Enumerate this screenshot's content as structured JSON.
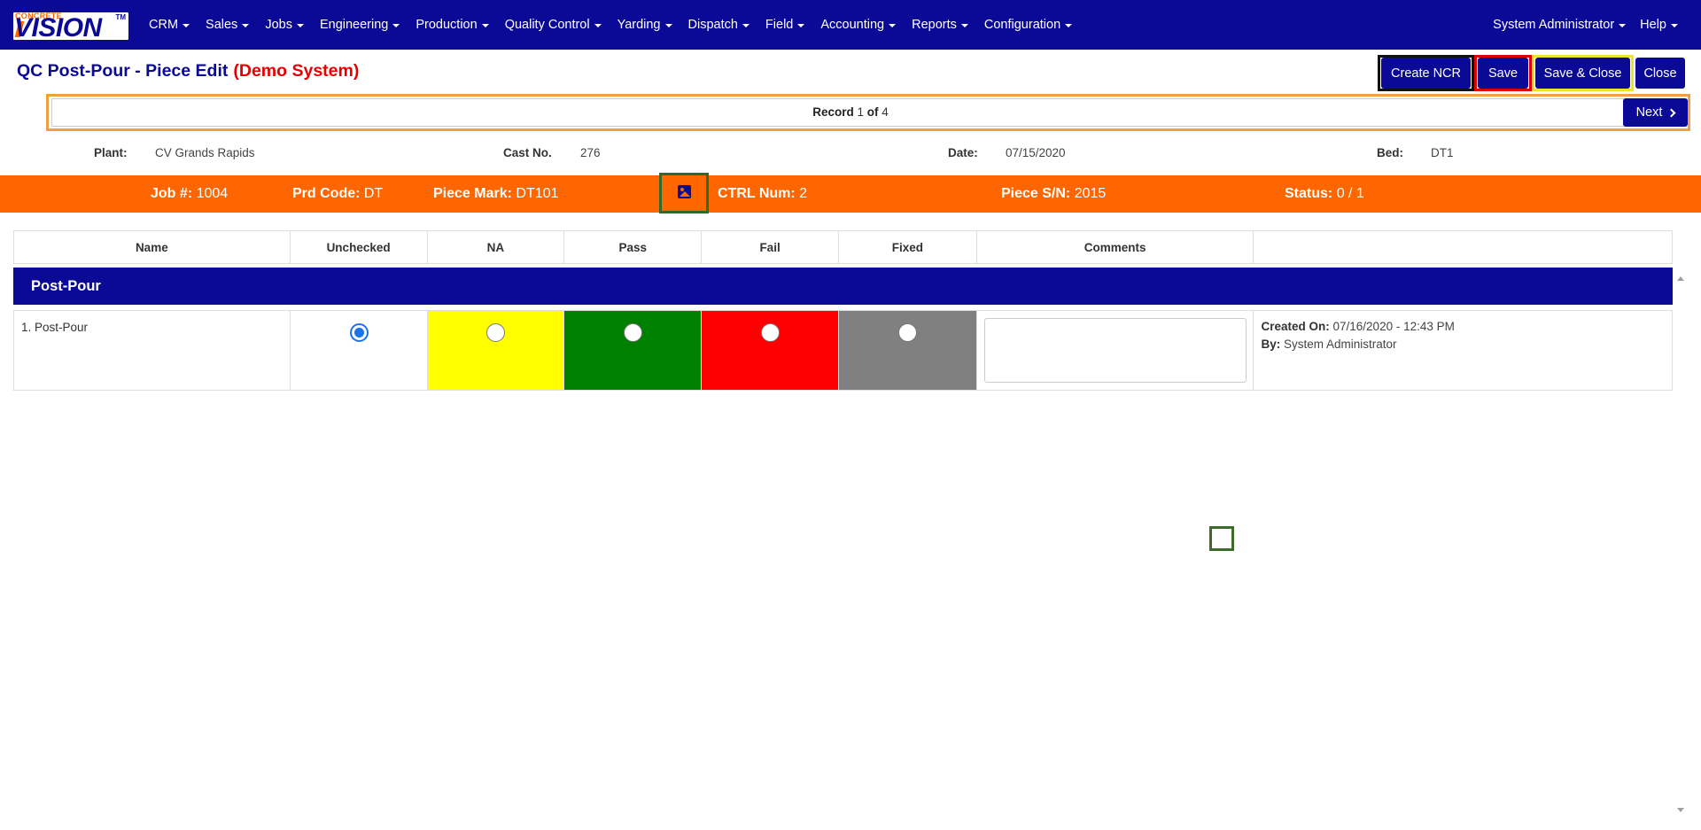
{
  "brand": {
    "top_text": "CONCRETE",
    "main_text": "VISION",
    "tm": "TM"
  },
  "nav": {
    "items": [
      "CRM",
      "Sales",
      "Jobs",
      "Engineering",
      "Production",
      "Quality Control",
      "Yarding",
      "Dispatch",
      "Field",
      "Accounting",
      "Reports",
      "Configuration"
    ],
    "user": "System Administrator",
    "help": "Help"
  },
  "header": {
    "title": "QC Post-Pour - Piece Edit",
    "demo_label": "(Demo System)",
    "buttons": {
      "create_ncr": "Create NCR",
      "save": "Save",
      "save_close": "Save & Close",
      "close": "Close"
    }
  },
  "record_nav": {
    "record_word": "Record",
    "current": "1",
    "of_word": "of",
    "total": "4",
    "next": "Next"
  },
  "info": {
    "plant_label": "Plant:",
    "plant": "CV Grands Rapids",
    "cast_label": "Cast No.",
    "cast": "276",
    "date_label": "Date:",
    "date": "07/15/2020",
    "bed_label": "Bed:",
    "bed": "DT1"
  },
  "piece": {
    "job_label": "Job #:",
    "job": "1004",
    "prd_label": "Prd Code:",
    "prd": "DT",
    "mark_label": "Piece Mark:",
    "mark": "DT101",
    "ctrl_label": "CTRL Num:",
    "ctrl": "2",
    "sn_label": "Piece S/N:",
    "sn": "2015",
    "status_label": "Status:",
    "status": "0 / 1"
  },
  "grid": {
    "columns": [
      "Name",
      "Unchecked",
      "NA",
      "Pass",
      "Fail",
      "Fixed",
      "Comments",
      ""
    ],
    "group": "Post-Pour",
    "rows": [
      {
        "name": "1. Post-Pour",
        "selected": "Unchecked",
        "comment": "",
        "created_label": "Created On:",
        "created": "07/16/2020 - 12:43 PM",
        "by_label": "By:",
        "by": "System Administrator"
      }
    ]
  },
  "colors": {
    "nav_bg": "#0a0a96",
    "orange": "#ff6600",
    "na": "#ffff00",
    "pass": "#008000",
    "fail": "#ff0000",
    "fixed": "#808080",
    "demo_red": "#e60000"
  }
}
